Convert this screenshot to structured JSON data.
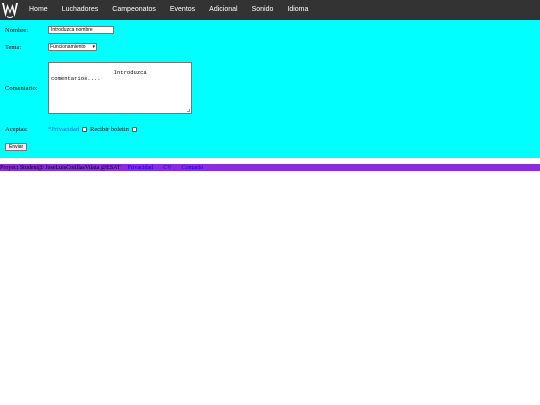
{
  "nav": {
    "items": [
      {
        "label": "Home"
      },
      {
        "label": "Luchadores"
      },
      {
        "label": "Campeonatos"
      },
      {
        "label": "Eventos"
      },
      {
        "label": "Adicional"
      },
      {
        "label": "Sonido"
      },
      {
        "label": "Idioma"
      }
    ]
  },
  "form": {
    "nombre_label": "Nombre:",
    "nombre_value": "Introduzca nombre",
    "tema_label": "Tema:",
    "tema_selected": "Funcionamiento",
    "comentario_label": "Comentario:",
    "comentario_placeholder": "               Introduzca\ncomentarios....",
    "aceptas_label": "Aceptas:",
    "privacidad_prefix": "*",
    "privacidad_link": "Privacidad",
    "boletin_label": "Recibir boletin",
    "submit_label": "Enviar"
  },
  "footer": {
    "text": "Proyect Student@ JoseLuisCotillasVilata @ESAT",
    "links": [
      {
        "label": "Privacidad"
      },
      {
        "label": "CV"
      },
      {
        "label": "Contacto"
      }
    ]
  },
  "colors": {
    "nav_bg": "#333333",
    "panel_bg": "#00ffff",
    "footer_bg": "#8a2be2",
    "link": "#0066cc"
  }
}
